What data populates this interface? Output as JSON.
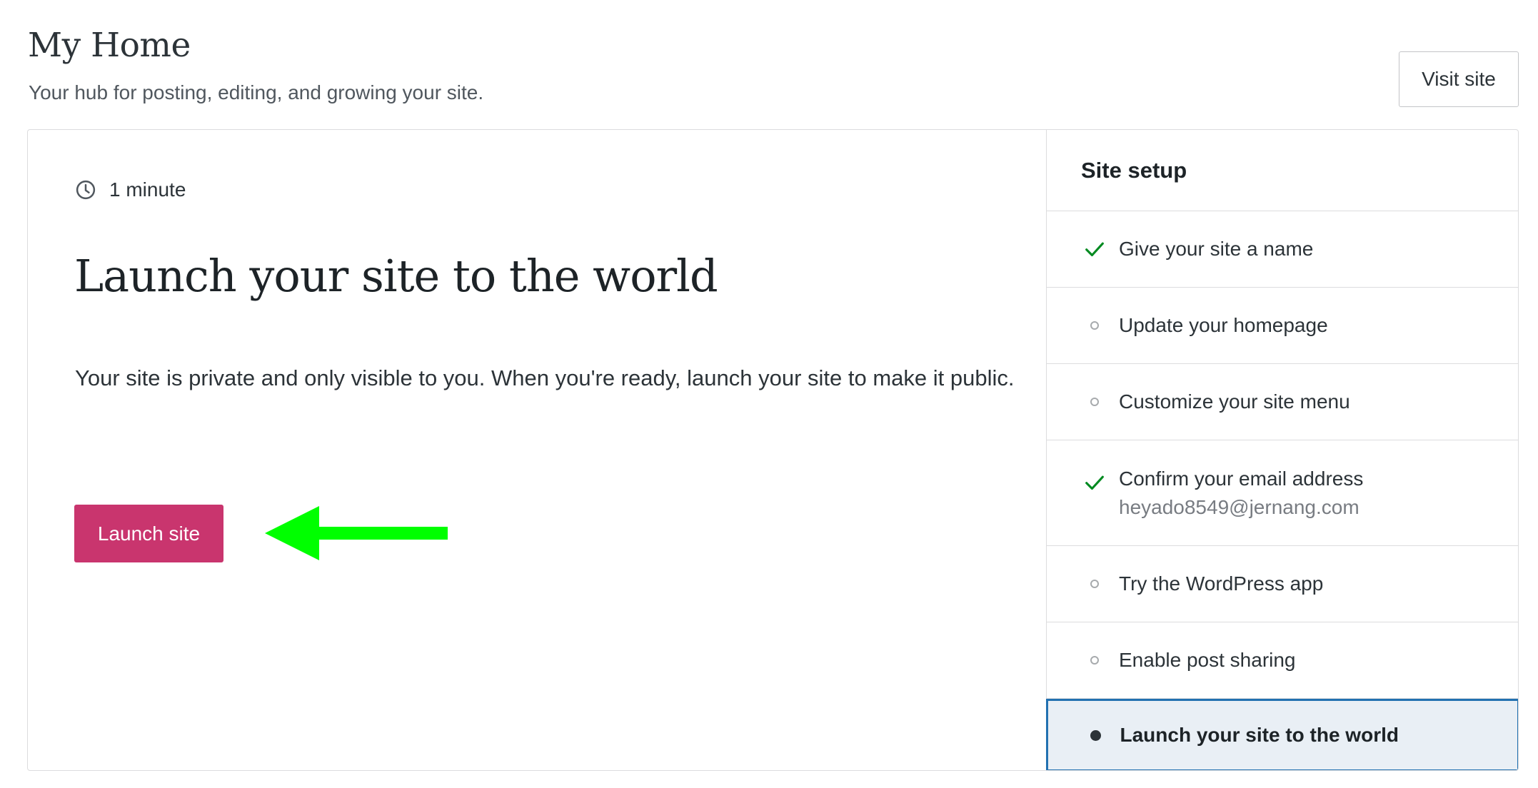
{
  "header": {
    "title": "My Home",
    "subtitle": "Your hub for posting, editing, and growing your site.",
    "visit_site_label": "Visit site"
  },
  "task": {
    "duration": "1 minute",
    "heading": "Launch your site to the world",
    "description": "Your site is private and only visible to you. When you're ready, launch your site to make it public.",
    "button_label": "Launch site"
  },
  "colors": {
    "launch_button": "#c9356e",
    "arrow_annotation": "#00ff00",
    "check_green": "#008a20",
    "active_border": "#2271b1",
    "active_background": "#e9eff5"
  },
  "checklist": {
    "title": "Site setup",
    "items": [
      {
        "label": "Give your site a name",
        "status": "complete",
        "icon": "check-icon"
      },
      {
        "label": "Update your homepage",
        "status": "incomplete",
        "icon": "circle-icon"
      },
      {
        "label": "Customize your site menu",
        "status": "incomplete",
        "icon": "circle-icon"
      },
      {
        "label": "Confirm your email address",
        "sublabel": "heyado8549@jernang.com",
        "status": "complete",
        "icon": "check-icon"
      },
      {
        "label": "Try the WordPress app",
        "status": "incomplete",
        "icon": "circle-icon"
      },
      {
        "label": "Enable post sharing",
        "status": "incomplete",
        "icon": "circle-icon"
      },
      {
        "label": "Launch your site to the world",
        "status": "active",
        "icon": "bullet-icon"
      }
    ]
  }
}
